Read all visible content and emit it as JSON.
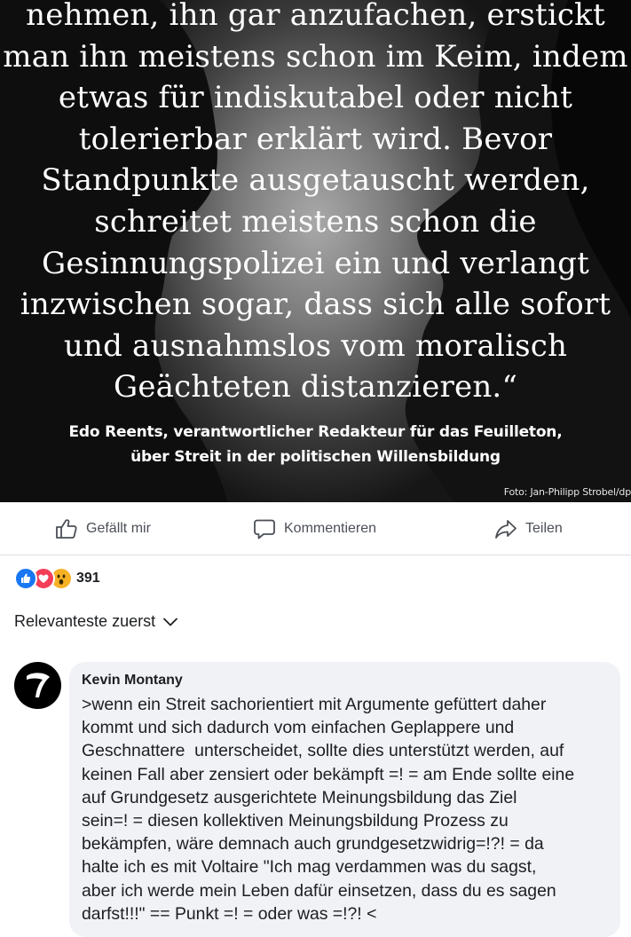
{
  "post": {
    "quote_lines": [
      "nehmen, ihn gar anzufachen, erstickt",
      "man ihn meistens schon im Keim, indem",
      "etwas für indiskutabel oder nicht",
      "tolerierbar erklärt wird. Bevor",
      "Standpunkte ausgetauscht werden,",
      "schreitet meistens schon die",
      "Gesinnungspolizei ein und verlangt",
      "inzwischen sogar, dass sich alle sofort",
      "und ausnahmslos vom moralisch",
      "Geächteten distanzieren.“"
    ],
    "attribution_lines": [
      "Edo Reents, verantwortlicher Redakteur für das Feuilleton,",
      "über Streit in der politischen Willensbildung"
    ],
    "photo_credit": "Foto: Jan-Philipp Strobel/dp"
  },
  "actions": {
    "like_label": "Gefällt mir",
    "comment_label": "Kommentieren",
    "share_label": "Teilen"
  },
  "reactions": {
    "icons": [
      "like-reaction",
      "love-reaction",
      "wow-reaction"
    ],
    "count": "391"
  },
  "sort": {
    "label": "Relevanteste zuerst"
  },
  "comment": {
    "author": "Kevin Montany",
    "lines": [
      ">wenn ein Streit sachorientiert mit Argumente gefüttert daher",
      "kommt und sich dadurch vom einfachen Geplappere und",
      "Geschnattere  unterscheidet, sollte dies unterstützt werden, auf",
      "keinen Fall aber zensiert oder bekämpft =! = am Ende sollte eine",
      "auf Grundgesetz ausgerichtete Meinungsbildung das Ziel",
      "sein=! = diesen kollektiven Meinungsbildung Prozess zu",
      "bekämpfen, wäre demnach auch grundgesetzwidrig=!?! = da",
      "halte ich es mit Voltaire \"Ich mag verdammen was du sagst,",
      "aber ich werde mein Leben dafür einsetzen, dass du es sagen",
      "darfst!!!\" == Punkt =! = oder was =!?! <"
    ]
  },
  "colors": {
    "like_blue": "#1877f2",
    "love_red": "#f33e58",
    "wow_yellow": "#f7b125",
    "bubble_bg": "#f0f2f5"
  }
}
